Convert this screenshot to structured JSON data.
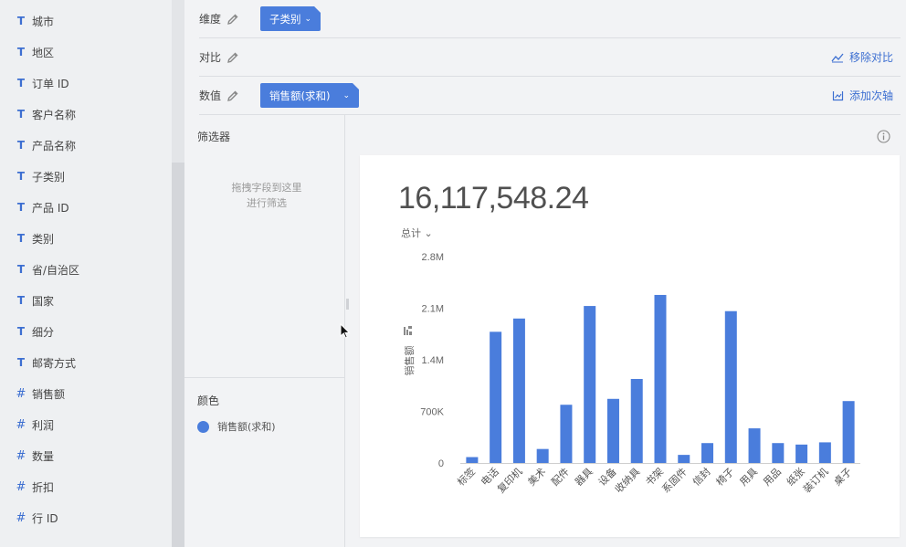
{
  "fields": [
    {
      "type": "T",
      "label": "城市"
    },
    {
      "type": "T",
      "label": "地区"
    },
    {
      "type": "T",
      "label": "订单 ID"
    },
    {
      "type": "T",
      "label": "客户名称"
    },
    {
      "type": "T",
      "label": "产品名称"
    },
    {
      "type": "T",
      "label": "子类别"
    },
    {
      "type": "T",
      "label": "产品 ID"
    },
    {
      "type": "T",
      "label": "类别"
    },
    {
      "type": "T",
      "label": "省/自治区"
    },
    {
      "type": "T",
      "label": "国家"
    },
    {
      "type": "T",
      "label": "细分"
    },
    {
      "type": "T",
      "label": "邮寄方式"
    },
    {
      "type": "#",
      "label": "销售额"
    },
    {
      "type": "#",
      "label": "利润"
    },
    {
      "type": "#",
      "label": "数量"
    },
    {
      "type": "#",
      "label": "折扣"
    },
    {
      "type": "#",
      "label": "行 ID"
    }
  ],
  "shelves": {
    "dimension": {
      "label": "维度",
      "pill": "子类别",
      "pill_chevron": "⌄"
    },
    "compare": {
      "label": "对比",
      "action": "移除对比"
    },
    "value": {
      "label": "数值",
      "pill": "销售额(求和)",
      "pill_chevron": "⌄",
      "action": "添加次轴"
    }
  },
  "filter": {
    "title": "筛选器",
    "drop_line1": "拖拽字段到这里",
    "drop_line2": "进行筛选"
  },
  "color": {
    "title": "颜色",
    "legend_label": "销售额(求和)",
    "legend_color": "#4a7ddc"
  },
  "kpi": {
    "value": "16,117,548.24",
    "aggregation": "总计 ⌄"
  },
  "chart_data": {
    "type": "bar",
    "ylabel": "销售额",
    "ylim": [
      0,
      2800000
    ],
    "y_ticks": [
      "0",
      "700K",
      "1.4M",
      "2.1M",
      "2.8M"
    ],
    "bar_color": "#4a7ddc",
    "categories": [
      "标签",
      "电话",
      "复印机",
      "美术",
      "配件",
      "器具",
      "设备",
      "收纳具",
      "书架",
      "系固件",
      "信封",
      "椅子",
      "用具",
      "用品",
      "纸张",
      "装订机",
      "桌子"
    ],
    "values": [
      80000,
      1780000,
      1960000,
      190000,
      790000,
      2130000,
      870000,
      1140000,
      2280000,
      110000,
      270000,
      2060000,
      470000,
      270000,
      250000,
      280000,
      840000
    ]
  }
}
